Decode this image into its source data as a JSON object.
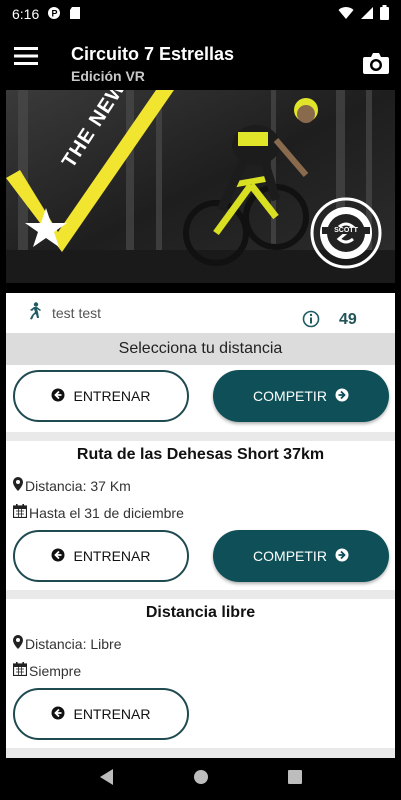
{
  "status": {
    "time": "6:16"
  },
  "header": {
    "title": "Circuito 7 Estrellas",
    "subtitle": "Edición VR"
  },
  "banner": {
    "text": "THE NEW RACE",
    "brand": "SCOTT"
  },
  "user": {
    "name": "test test",
    "points": "49"
  },
  "select_title": "Selecciona tu distancia",
  "general": {
    "train_label": "ENTRENAR",
    "compete_label": "COMPETIR"
  },
  "routes": [
    {
      "title": "Ruta de las Dehesas Short 37km",
      "distance": "Distancia: 37 Km",
      "date": "Hasta el 31 de diciembre",
      "train_label": "ENTRENAR",
      "compete_label": "COMPETIR"
    },
    {
      "title": "Distancia libre",
      "distance": "Distancia: Libre",
      "date": "Siempre",
      "train_label": "ENTRENAR"
    }
  ],
  "colors": {
    "accent": "#0f5058",
    "banner_yellow": "#f2e530"
  }
}
